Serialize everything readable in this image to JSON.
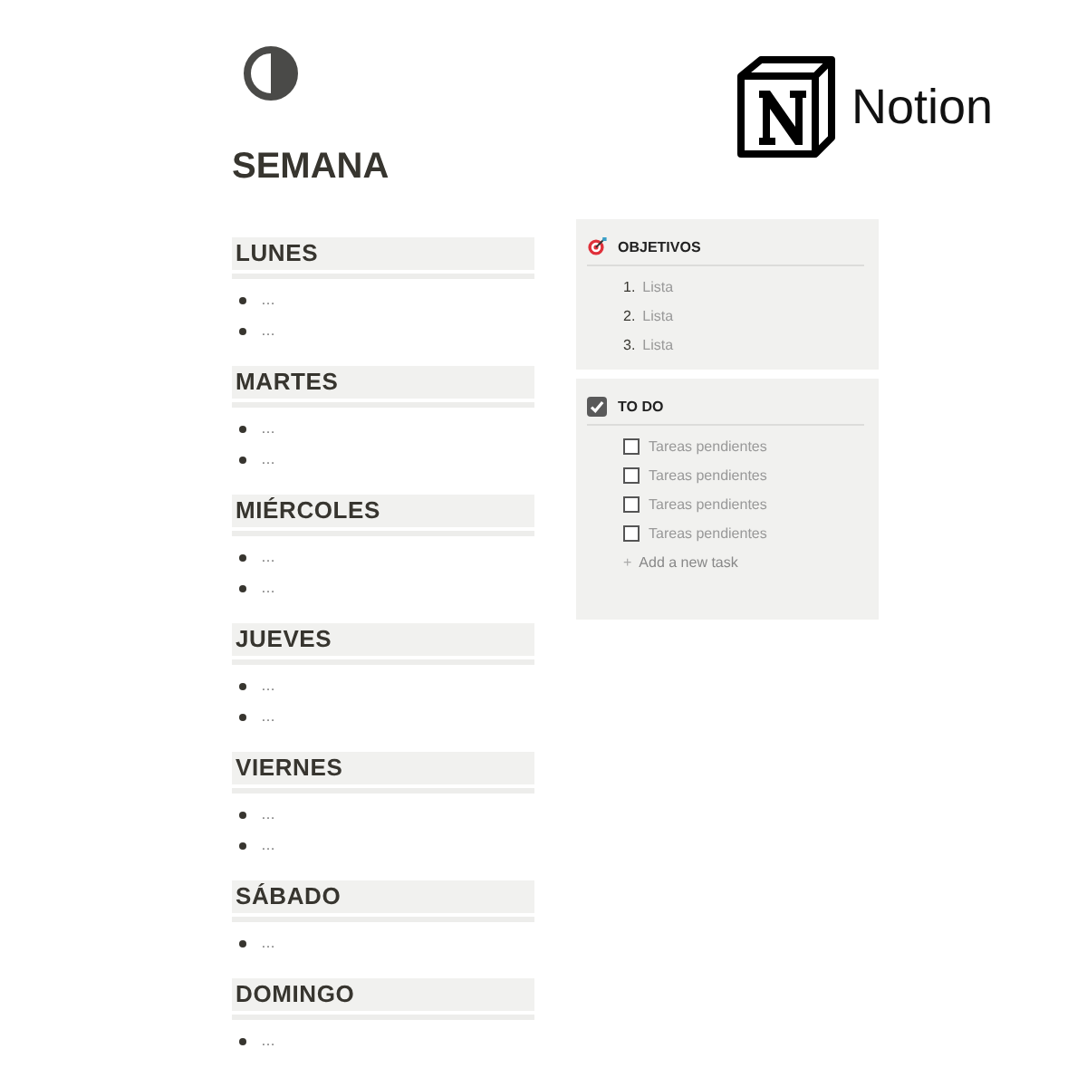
{
  "page": {
    "title": "SEMANA"
  },
  "logo": {
    "text": "Notion"
  },
  "days": [
    {
      "name": "LUNES",
      "items": [
        "…",
        "…"
      ]
    },
    {
      "name": "MARTES",
      "items": [
        "…",
        "…"
      ]
    },
    {
      "name": "MIÉRCOLES",
      "items": [
        "…",
        "…"
      ]
    },
    {
      "name": "JUEVES",
      "items": [
        "…",
        "…"
      ]
    },
    {
      "name": "VIERNES",
      "items": [
        "…",
        "…"
      ]
    },
    {
      "name": "SÁBADO",
      "items": [
        "…"
      ]
    },
    {
      "name": "DOMINGO",
      "items": [
        "…"
      ]
    }
  ],
  "objectives": {
    "title": "OBJETIVOS",
    "items": [
      {
        "number": "1.",
        "text": "Lista"
      },
      {
        "number": "2.",
        "text": "Lista"
      },
      {
        "number": "3.",
        "text": "Lista"
      }
    ]
  },
  "todo": {
    "title": "TO DO",
    "tasks": [
      {
        "text": "Tareas pendientes",
        "checked": false
      },
      {
        "text": "Tareas pendientes",
        "checked": false
      },
      {
        "text": "Tareas pendientes",
        "checked": false
      },
      {
        "text": "Tareas pendientes",
        "checked": false
      }
    ],
    "add_icon": "+",
    "add_label": "Add a new task"
  }
}
